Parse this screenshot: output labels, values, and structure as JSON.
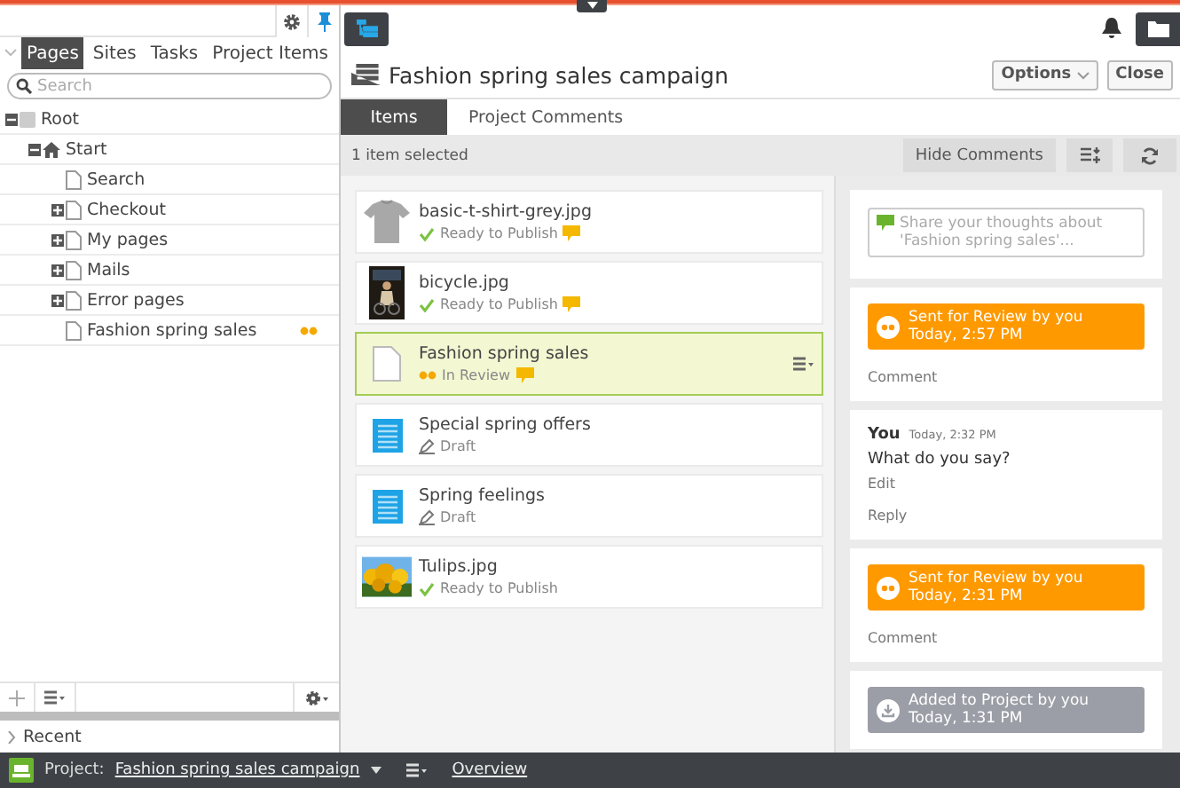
{
  "left_panel": {
    "tabs": [
      {
        "label": "Pages",
        "selected": true
      },
      {
        "label": "Sites",
        "selected": false
      },
      {
        "label": "Tasks",
        "selected": false
      },
      {
        "label": "Project Items",
        "selected": false
      }
    ],
    "search": {
      "placeholder": "Search"
    },
    "tree": [
      {
        "label": "Root",
        "kind": "root",
        "expanded": true,
        "in_review": false,
        "children": [
          {
            "label": "Start",
            "kind": "home",
            "expanded": true,
            "in_review": false,
            "children": [
              {
                "label": "Search",
                "kind": "page",
                "in_review": false
              },
              {
                "label": "Checkout",
                "kind": "page",
                "expanded": false,
                "in_review": false
              },
              {
                "label": "My pages",
                "kind": "page",
                "expanded": false,
                "in_review": false
              },
              {
                "label": "Mails",
                "kind": "page",
                "expanded": false,
                "in_review": false
              },
              {
                "label": "Error pages",
                "kind": "page",
                "expanded": false,
                "in_review": false
              },
              {
                "label": "Fashion spring sales",
                "kind": "page",
                "in_review": true
              }
            ]
          }
        ]
      }
    ],
    "recent": {
      "label": "Recent",
      "expanded": false
    }
  },
  "project": {
    "title": "Fashion spring sales campaign",
    "buttons": [
      {
        "label": "Options",
        "dropdown": true
      },
      {
        "label": "Close",
        "dropdown": false
      }
    ],
    "tabs": [
      {
        "label": "Items",
        "selected": true
      },
      {
        "label": "Project Comments",
        "selected": false
      }
    ],
    "selection_info": "1 item selected",
    "hide_comments": "Hide Comments",
    "items": [
      {
        "name": "basic-t-shirt-grey.jpg",
        "status": {
          "kind": "ready",
          "label": "Ready to Publish"
        },
        "has_comments": true,
        "selected": false
      },
      {
        "name": "bicycle.jpg",
        "status": {
          "kind": "ready",
          "label": "Ready to Publish"
        },
        "has_comments": true,
        "selected": false
      },
      {
        "name": "Fashion spring sales",
        "kind": "page",
        "status": {
          "kind": "review",
          "label": "In Review"
        },
        "has_comments": true,
        "selected": true
      },
      {
        "name": "Special spring offers",
        "kind": "article",
        "status": {
          "kind": "draft",
          "label": "Draft"
        },
        "has_comments": false,
        "selected": false
      },
      {
        "name": "Spring feelings",
        "kind": "article",
        "status": {
          "kind": "draft",
          "label": "Draft"
        },
        "has_comments": false,
        "selected": false
      },
      {
        "name": "Tulips.jpg",
        "status": {
          "kind": "ready",
          "label": "Ready to Publish"
        },
        "has_comments": false,
        "selected": false
      }
    ],
    "comments": {
      "placeholder": "Share your thoughts about 'Fashion spring sales'...",
      "entries": [
        {
          "kind": "review",
          "color": "#ff9900",
          "title": "Sent for Review by you",
          "time": "Today, 2:57 PM",
          "action": "Comment"
        },
        {
          "kind": "comment",
          "author": "You",
          "time": "Today, 2:32 PM",
          "text": "What do you say?",
          "edit": "Edit",
          "action": "Reply"
        },
        {
          "kind": "review",
          "color": "#ff9900",
          "title": "Sent for Review by you",
          "time": "Today, 2:31 PM",
          "action": "Comment"
        },
        {
          "kind": "added",
          "color": "#9b9ea6",
          "title": "Added to Project by you",
          "time": "Today, 1:31 PM"
        }
      ]
    }
  },
  "bottom_bar": {
    "label": "Project:",
    "project_link": "Fashion spring sales campaign",
    "overview": "Overview"
  }
}
